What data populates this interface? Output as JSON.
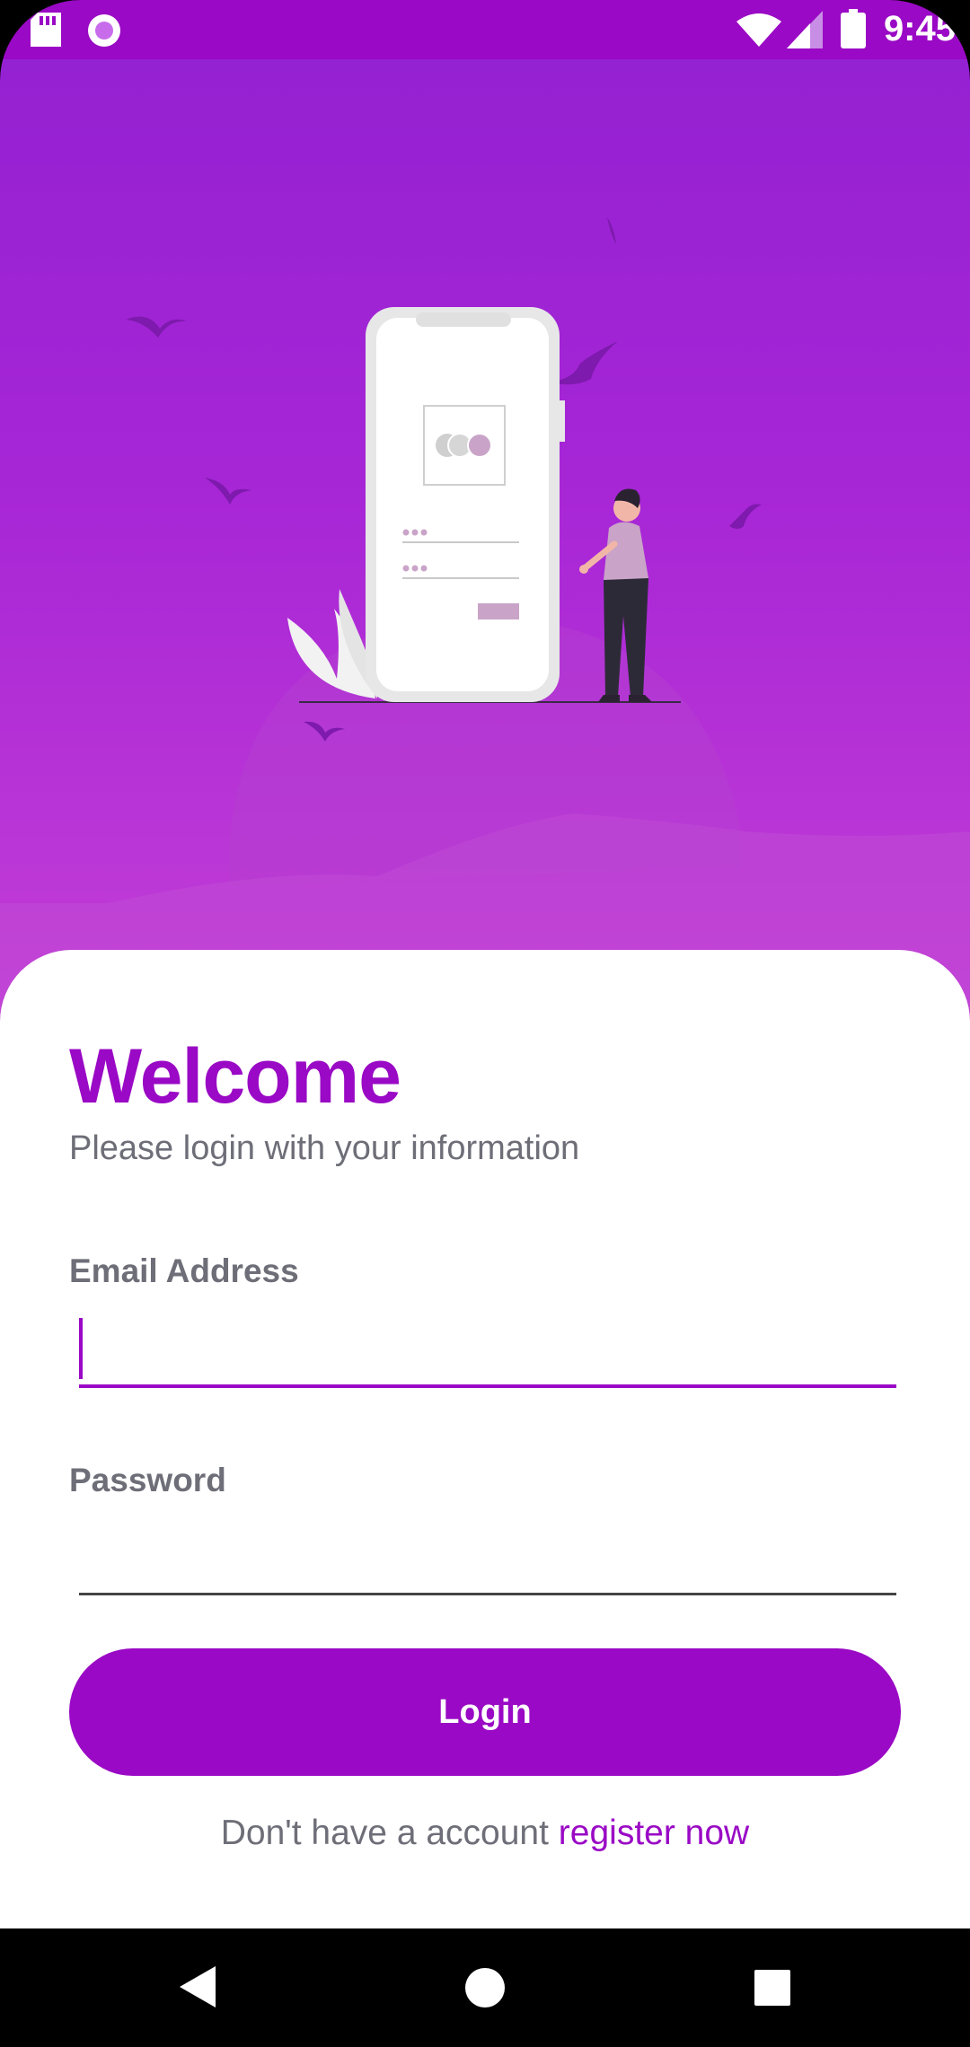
{
  "status_bar": {
    "time": "9:45"
  },
  "login": {
    "title": "Welcome",
    "subtitle": "Please login with your information",
    "email_label": "Email Address",
    "email_value": "",
    "password_label": "Password",
    "password_value": "",
    "login_button": "Login",
    "register_prompt": "Don't have a account",
    "register_link": "register now"
  },
  "colors": {
    "accent": "#9a09c5",
    "hero_top": "#9421d2",
    "hero_bottom": "#c43ed6",
    "muted_text": "#6e6e78"
  },
  "icons": [
    "sd-card-icon",
    "record-icon",
    "wifi-icon",
    "signal-icon",
    "battery-icon",
    "back-icon",
    "home-icon",
    "recents-icon"
  ]
}
